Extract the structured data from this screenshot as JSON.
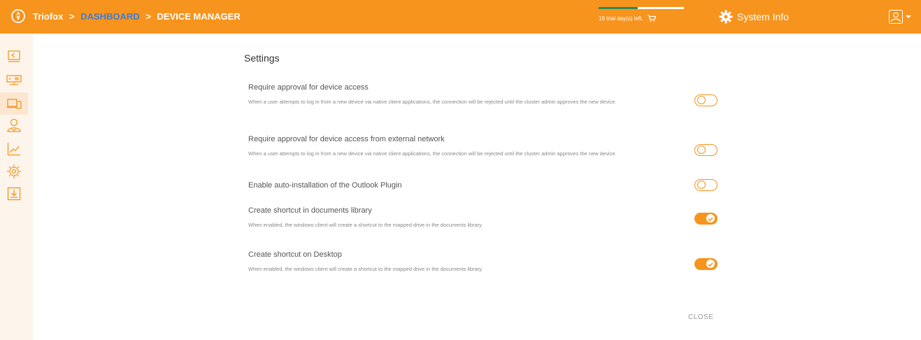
{
  "header": {
    "brand": "Triofox",
    "crumb_sep": ">",
    "crumb_dashboard": "DASHBOARD",
    "crumb_current": "DEVICE MANAGER",
    "trial_text": "16 trial day(s) left.",
    "trial_progress": 0.46,
    "system_info_label": "System Info",
    "colors": {
      "bar": "#f7941d",
      "link": "#3f7fd3",
      "progress": "#2e8b57"
    }
  },
  "sidebar": {
    "items": [
      {
        "name": "dashboard-icon"
      },
      {
        "name": "cluster-icon"
      },
      {
        "name": "devices-icon",
        "active": true
      },
      {
        "name": "users-icon"
      },
      {
        "name": "reports-icon"
      },
      {
        "name": "settings-icon"
      },
      {
        "name": "download-icon"
      }
    ]
  },
  "settings": {
    "title": "Settings",
    "rows": [
      {
        "label": "Require approval for device access",
        "desc": "When a user attempts to log in from a new device via native client applications, the connection will be rejected until the cluster admin approves the new device.",
        "enabled": false
      },
      {
        "label": "Require approval for device access from external network",
        "desc": "When a user attempts to log in from a new device via native client applications, the connection will be rejected until the cluster admin approves the new device.",
        "enabled": false
      },
      {
        "label": "Enable auto-installation of the Outlook Plugin",
        "desc": "",
        "enabled": false
      },
      {
        "label": "Create shortcut in documents library",
        "desc": "When enabled, the windows client will create a shortcut to the mapped drive in the documents library.",
        "enabled": true
      },
      {
        "label": "Create shortcut on Desktop",
        "desc": "When enabled, the windows client will create a shortcut to the mapped drive in the documents library.",
        "enabled": true
      }
    ],
    "close_label": "CLOSE"
  }
}
